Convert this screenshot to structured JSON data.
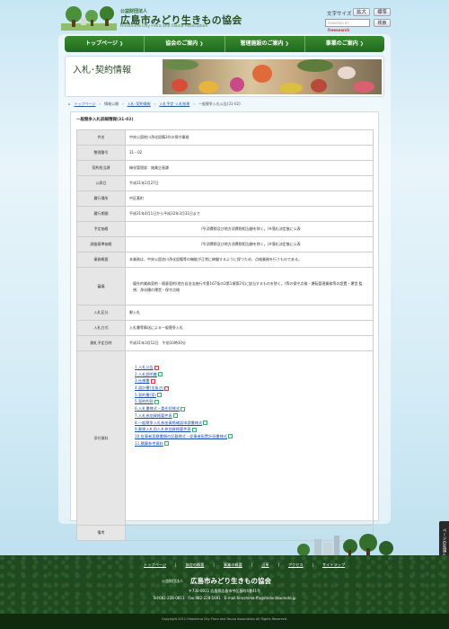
{
  "header": {
    "logo_small": "公益財団法人",
    "logo_main": "広島市みどり生きもの協会",
    "logo_en": "Hiroshima City Flora and Fauna Association",
    "fontsize_label": "文字サイズ",
    "fontsize_large": "拡大",
    "fontsize_standard": "標準",
    "search_placeholder": "POWERED BY",
    "search_brand": "freesearch",
    "search_button": "検索"
  },
  "nav": {
    "items": [
      {
        "label": "トップページ"
      },
      {
        "label": "協会のご案内"
      },
      {
        "label": "管理施設のご案内"
      },
      {
        "label": "事業のご案内"
      }
    ]
  },
  "page": {
    "title": "入札･契約情報"
  },
  "breadcrumb": {
    "items": [
      "トップページ",
      "情報公開",
      "入札･契約情報",
      "入札予定･入札結果",
      "一般競争入札公告(31-02)"
    ]
  },
  "section_title": "一般競争入札詳細情報(31-02)",
  "table": {
    "rows": [
      {
        "label": "件名",
        "value": "中央公園地川浄化設備3外の保守業務"
      },
      {
        "label": "整理番号",
        "value": "31－02"
      },
      {
        "label": "契約担当課",
        "value": "緑化管理部　施業企画課"
      },
      {
        "label": "公表日",
        "value": "平成31年2月27日"
      },
      {
        "label": "履行場所",
        "value": "中区基町"
      },
      {
        "label": "履行期間",
        "value": "平成31年4月1日から平成32年3月31日まで"
      },
      {
        "label": "予定価格",
        "value": "円(消費税及び地方消費税相当額を除く。)※落札決定後に公表"
      },
      {
        "label": "調査基準価格",
        "value": "円(消費税及び地方消費税相当額を除く。)※落札決定後に公表"
      },
      {
        "label": "業務概要",
        "value": "本業務は、中央公園池川浄化設備等の機能が正常に稼働するように保つため、点検業務を行うものである。"
      },
      {
        "label": "審議",
        "value": "優先的業務契約・随意契約(地方自治法施行令第167条の2第1項第2号に該当するものを除く。)等の保守点検・運転管理業務等の設置・運営 監視、浄化槽の運営・保守点検"
      },
      {
        "label": "入札区分",
        "value": "郵入札"
      },
      {
        "label": "入札方式",
        "value": "入札書等郵送による一般競争入札"
      },
      {
        "label": "開札予定日時",
        "value": "平成31年3月12日　午前10時30分"
      },
      {
        "label": "添付資料",
        "value": ""
      },
      {
        "label": "備考",
        "value": ""
      }
    ],
    "documents": [
      {
        "label": "1.入札公告",
        "icon": "pdf"
      },
      {
        "label": "2.入札説明書",
        "icon": "doc"
      },
      {
        "label": "3.仕様書",
        "icon": "pdf"
      },
      {
        "label": "4.設計書(金抜き)",
        "icon": "pdf"
      },
      {
        "label": "5.契約書(案)",
        "icon": "doc"
      },
      {
        "label": "5.契約約款",
        "icon": "doc"
      },
      {
        "label": "6.入札書様式・委任状様式",
        "icon": "doc"
      },
      {
        "label": "7.入札参加資格要件表",
        "icon": "doc"
      },
      {
        "label": "8.一般競争入札参加資格確認申請書様式",
        "icon": "doc"
      },
      {
        "label": "9.郵便入札用入札参加資格要件表",
        "icon": "doc"
      },
      {
        "label": "10.従事者実績書類の記載様式・従事者配置計画書様式",
        "icon": "doc"
      },
      {
        "label": "11.積算参考資料",
        "icon": "doc"
      }
    ]
  },
  "totop": "ページの先頭へ",
  "footer": {
    "links": [
      "トップページ",
      "協会の概要",
      "事業の概要",
      "沿革",
      "アクセス",
      "サイトマップ"
    ],
    "org_small": "公益財団法人",
    "org_name": "広島市みどり生きもの協会",
    "address": "〒730-0011 広島県広島市中区基町4番41号",
    "contact": "Tel:082-228-0811　Fax:082-228-1691　E-mail:hiroshima-ffa@midoridoumoto.jp",
    "copyright": "Copyright 2012 Hiroshima City Flora and Fauna Association All Rights Reserved."
  },
  "colors": {
    "nav_green": "#2e7d2a",
    "footer_green": "#1f4a1f",
    "link_blue": "#1a4fb0"
  }
}
